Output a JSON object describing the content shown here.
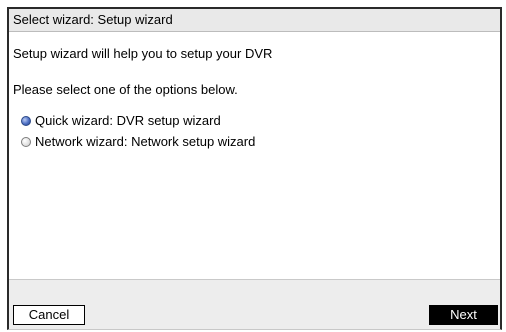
{
  "window": {
    "title": "Select wizard: Setup wizard"
  },
  "content": {
    "intro": "Setup wizard will help you to setup your DVR",
    "instruction": "Please select one of the options below.",
    "options": [
      {
        "label": "Quick wizard: DVR setup wizard",
        "selected": true
      },
      {
        "label": "Network wizard: Network setup wizard",
        "selected": false
      }
    ]
  },
  "footer": {
    "cancel_label": "Cancel",
    "next_label": "Next"
  },
  "colors": {
    "selected_radio": "#3f5fb5",
    "next_button_bg": "#000000",
    "title_bar_bg": "#e9e9e9",
    "footer_bg": "#ededed"
  }
}
